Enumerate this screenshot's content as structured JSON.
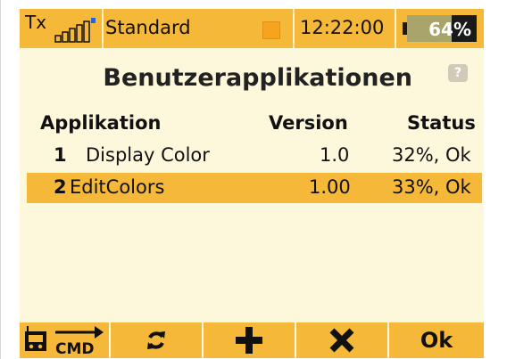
{
  "statusbar": {
    "tx_label": "Tx",
    "model_name": "Standard",
    "model_color": "#f6a41c",
    "time": "12:22:00",
    "battery_text": "64%",
    "battery_level": 0.64
  },
  "page": {
    "title": "Benutzerapplikationen",
    "help_icon": "?"
  },
  "table": {
    "headers": {
      "app": "Applikation",
      "version": "Version",
      "status": "Status"
    },
    "rows": [
      {
        "num": "1",
        "name": "Display Color",
        "version": "1.0",
        "status": "32%, Ok"
      },
      {
        "num": "2",
        "name": "EditColors",
        "version": "1.00",
        "status": "33%, Ok",
        "selected": true
      }
    ]
  },
  "toolbar": {
    "cmd_label": "CMD",
    "ok_label": "Ok",
    "icons": [
      "transmitter-cmd-icon",
      "refresh-icon",
      "plus-icon",
      "close-icon"
    ]
  },
  "colors": {
    "accent": "#f6b839",
    "background": "#fdf7dc"
  }
}
